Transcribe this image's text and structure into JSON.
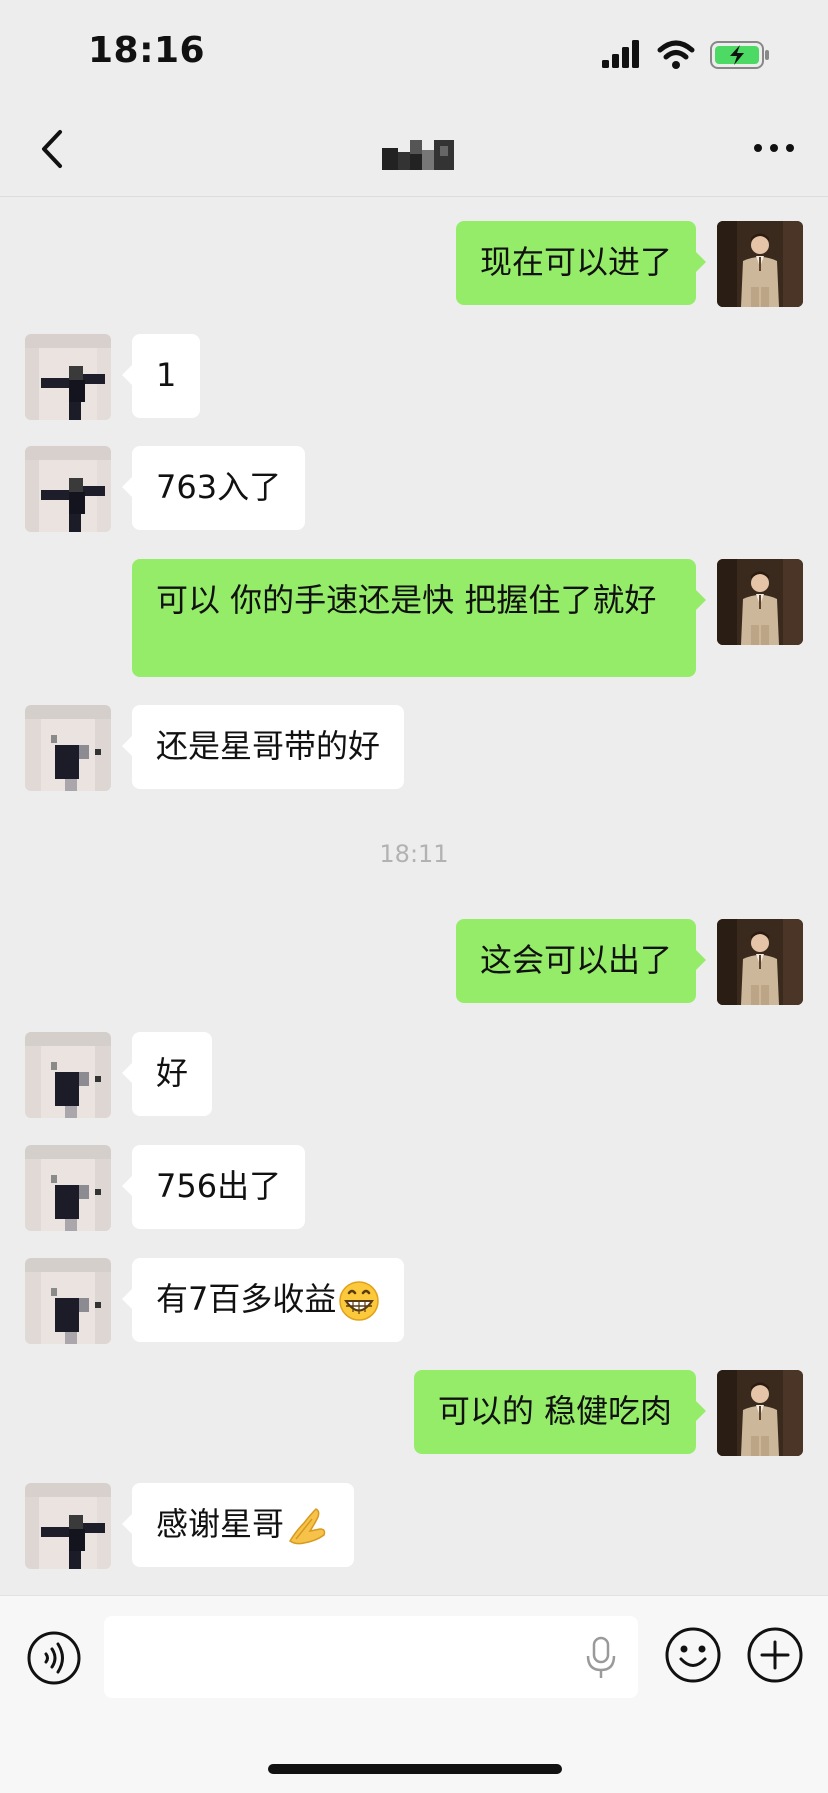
{
  "status_bar": {
    "time": "18:16",
    "battery_color": "#4cd964"
  },
  "header": {
    "title_redacted": true,
    "back_icon": "chevron-left-icon",
    "more_icon": "more-dots-icon"
  },
  "colors": {
    "background": "#ededed",
    "outgoing_bubble": "#95ec69",
    "incoming_bubble": "#ffffff",
    "timestamp_text": "#b2b2b2"
  },
  "messages": [
    {
      "side": "right",
      "text": "现在可以进了"
    },
    {
      "side": "left",
      "text": "1"
    },
    {
      "side": "left",
      "text": "763入了"
    },
    {
      "side": "right",
      "text": "可以 你的手速还是快 把握住了就好"
    },
    {
      "side": "left",
      "text": "还是星哥带的好"
    },
    {
      "side": "time",
      "text": "18:11"
    },
    {
      "side": "right",
      "text": "这会可以出了"
    },
    {
      "side": "left",
      "text": "好"
    },
    {
      "side": "left",
      "text": "756出了"
    },
    {
      "side": "left",
      "text": "有7百多收益",
      "emoji": "grinning-face-icon"
    },
    {
      "side": "right",
      "text": "可以的  稳健吃肉"
    },
    {
      "side": "left",
      "text": "感谢星哥",
      "emoji": "folded-hands-icon"
    }
  ],
  "input_bar": {
    "placeholder": "",
    "value": "",
    "voice_icon": "voice-icon",
    "mic_icon": "microphone-icon",
    "emoji_icon": "smiley-icon",
    "plus_icon": "plus-circle-icon"
  }
}
